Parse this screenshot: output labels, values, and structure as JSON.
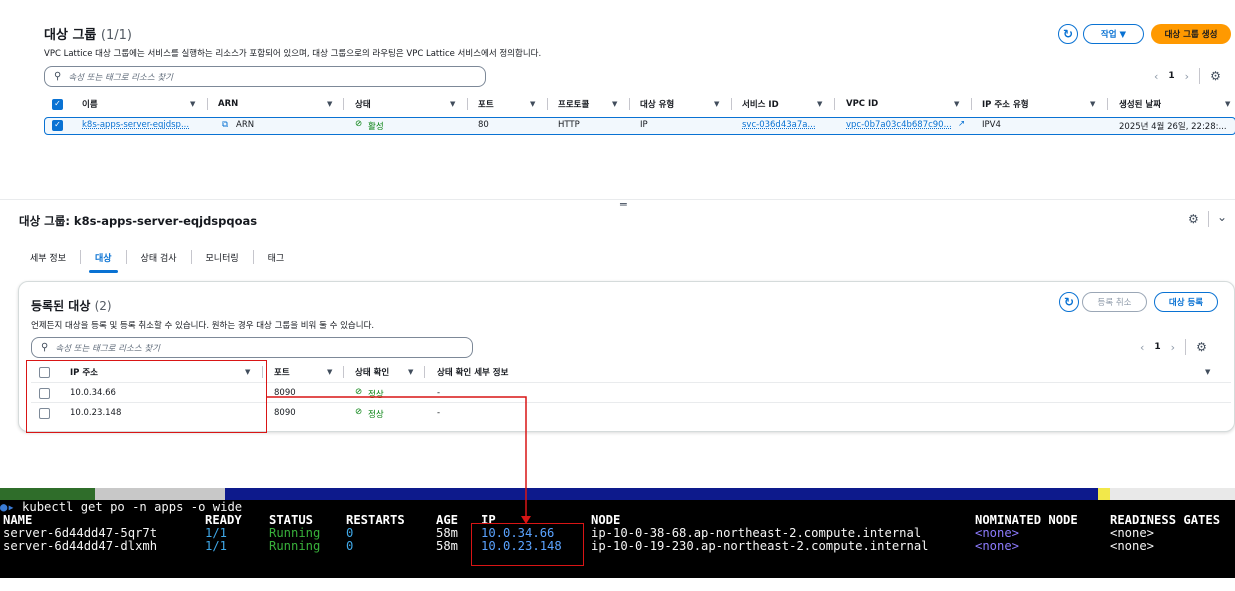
{
  "target_groups_panel": {
    "title": "대상 그룹",
    "count": "(1/1)",
    "description": "VPC Lattice 대상 그룹에는 서비스를 실행하는 리소스가 포함되어 있으며, 대상 그룹으로의 라우팅은 VPC Lattice 서비스에서 정의합니다.",
    "actions_label": "작업 ▼",
    "create_label": "대상 그룹 생성",
    "search_placeholder": "속성 또는 태그로 리소스 찾기",
    "page": "1",
    "columns": [
      "이름",
      "ARN",
      "상태",
      "포트",
      "프로토콜",
      "대상 유형",
      "서비스 ID",
      "VPC ID",
      "IP 주소 유형",
      "생성된 날짜"
    ],
    "row": {
      "name": "k8s-apps-server-eqjdsp...",
      "arn": "ARN",
      "status": "활성",
      "port": "80",
      "protocol": "HTTP",
      "target_type": "IP",
      "service_id": "svc-036d43a7a...",
      "vpc_id": "vpc-0b7a03c4b687c90...",
      "ip_type": "IPV4",
      "created": "2025년 4월 26일, 22:28:..."
    }
  },
  "details_panel": {
    "title": "대상 그룹: k8s-apps-server-eqjdspqoas",
    "tabs": [
      "세부 정보",
      "대상",
      "상태 검사",
      "모니터링",
      "태그"
    ],
    "active_tab_index": 1,
    "registered": {
      "title": "등록된 대상",
      "count": "(2)",
      "description": "언제든지 대상을 등록 및 등록 취소할 수 있습니다. 원하는 경우 대상 그룹을 비워 둘 수 있습니다.",
      "deregister_label": "등록 취소",
      "register_label": "대상 등록",
      "search_placeholder": "속성 또는 태그로 리소스 찾기",
      "page": "1",
      "columns": [
        "IP 주소",
        "포트",
        "상태 확인",
        "상태 확인 세부 정보"
      ],
      "rows": [
        {
          "ip": "10.0.34.66",
          "port": "8090",
          "health": "정상",
          "detail": "-"
        },
        {
          "ip": "10.0.23.148",
          "port": "8090",
          "health": "정상",
          "detail": "-"
        }
      ]
    }
  },
  "terminal": {
    "command": "kubectl get po -n apps -o wide",
    "headers": {
      "name": "NAME",
      "ready": "READY",
      "status": "STATUS",
      "restarts": "RESTARTS",
      "age": "AGE",
      "ip": "IP",
      "node": "NODE",
      "nominated": "NOMINATED NODE",
      "gates": "READINESS GATES"
    },
    "pods": [
      {
        "name": "server-6d44dd47-5qr7t",
        "ready": "1/1",
        "status": "Running",
        "restarts": "0",
        "age": "58m",
        "ip": "10.0.34.66",
        "node": "ip-10-0-38-68.ap-northeast-2.compute.internal",
        "nominated": "<none>",
        "gates": "<none>"
      },
      {
        "name": "server-6d44dd47-dlxmh",
        "ready": "1/1",
        "status": "Running",
        "restarts": "0",
        "age": "58m",
        "ip": "10.0.23.148",
        "node": "ip-10-0-19-230.ap-northeast-2.compute.internal",
        "nominated": "<none>",
        "gates": "<none>"
      }
    ]
  },
  "colors": {
    "accent": "#0972d3",
    "primary_button": "#ff9900",
    "success": "#037f0c",
    "highlight_box": "#d91515"
  },
  "icons": [
    "refresh-icon",
    "search-icon",
    "gear-icon",
    "copy-icon",
    "external-link-icon",
    "check-circle-icon",
    "chevron-down-icon",
    "caret-down-icon"
  ]
}
